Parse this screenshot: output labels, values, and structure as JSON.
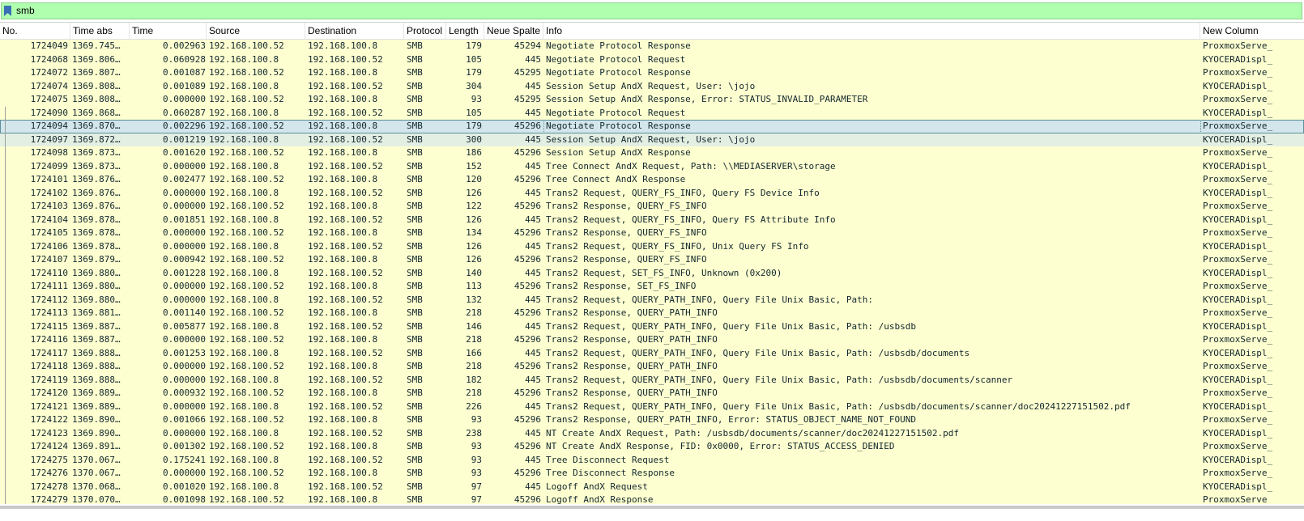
{
  "filter": {
    "value": "smb",
    "icon": "bookmark-icon",
    "bar_color": "#afffaf"
  },
  "columns": [
    "No.",
    "Time abs",
    "Time",
    "Source",
    "Destination",
    "Protocol",
    "Length",
    "Neue Spalte",
    "Info",
    "New Column"
  ],
  "colors": {
    "row_bg": "#feffd0",
    "selected_bg": "#d3e6eb",
    "hover_bg": "#e4efe3",
    "text": "#12272e"
  },
  "selected_index": 6,
  "hover_index": 7,
  "rows": [
    {
      "no": "1724049",
      "tabs": "1369.745…",
      "time": "0.002963",
      "src": "192.168.100.52",
      "dst": "192.168.100.8",
      "proto": "SMB",
      "len": "179",
      "ns": "45294",
      "info": "Negotiate Protocol Response",
      "nc": "ProxmoxServe_"
    },
    {
      "no": "1724068",
      "tabs": "1369.806…",
      "time": "0.060928",
      "src": "192.168.100.8",
      "dst": "192.168.100.52",
      "proto": "SMB",
      "len": "105",
      "ns": "445",
      "info": "Negotiate Protocol Request",
      "nc": "KYOCERADispl_"
    },
    {
      "no": "1724072",
      "tabs": "1369.807…",
      "time": "0.001087",
      "src": "192.168.100.52",
      "dst": "192.168.100.8",
      "proto": "SMB",
      "len": "179",
      "ns": "45295",
      "info": "Negotiate Protocol Response",
      "nc": "ProxmoxServe_"
    },
    {
      "no": "1724074",
      "tabs": "1369.808…",
      "time": "0.001089",
      "src": "192.168.100.8",
      "dst": "192.168.100.52",
      "proto": "SMB",
      "len": "304",
      "ns": "445",
      "info": "Session Setup AndX Request, User: \\jojo",
      "nc": "KYOCERADispl_"
    },
    {
      "no": "1724075",
      "tabs": "1369.808…",
      "time": "0.000000",
      "src": "192.168.100.52",
      "dst": "192.168.100.8",
      "proto": "SMB",
      "len": "93",
      "ns": "45295",
      "info": "Session Setup AndX Response, Error: STATUS_INVALID_PARAMETER",
      "nc": "ProxmoxServe_"
    },
    {
      "no": "1724090",
      "tabs": "1369.868…",
      "time": "0.060287",
      "src": "192.168.100.8",
      "dst": "192.168.100.52",
      "proto": "SMB",
      "len": "105",
      "ns": "445",
      "info": "Negotiate Protocol Request",
      "nc": "KYOCERADispl_"
    },
    {
      "no": "1724094",
      "tabs": "1369.870…",
      "time": "0.002296",
      "src": "192.168.100.52",
      "dst": "192.168.100.8",
      "proto": "SMB",
      "len": "179",
      "ns": "45296",
      "info": "Negotiate Protocol Response",
      "nc": "ProxmoxServe_"
    },
    {
      "no": "1724097",
      "tabs": "1369.872…",
      "time": "0.001219",
      "src": "192.168.100.8",
      "dst": "192.168.100.52",
      "proto": "SMB",
      "len": "300",
      "ns": "445",
      "info": "Session Setup AndX Request, User: \\jojo",
      "nc": "KYOCERADispl_"
    },
    {
      "no": "1724098",
      "tabs": "1369.873…",
      "time": "0.001620",
      "src": "192.168.100.52",
      "dst": "192.168.100.8",
      "proto": "SMB",
      "len": "186",
      "ns": "45296",
      "info": "Session Setup AndX Response",
      "nc": "ProxmoxServe_"
    },
    {
      "no": "1724099",
      "tabs": "1369.873…",
      "time": "0.000000",
      "src": "192.168.100.8",
      "dst": "192.168.100.52",
      "proto": "SMB",
      "len": "152",
      "ns": "445",
      "info": "Tree Connect AndX Request, Path: \\\\MEDIASERVER\\storage",
      "nc": "KYOCERADispl_"
    },
    {
      "no": "1724101",
      "tabs": "1369.876…",
      "time": "0.002477",
      "src": "192.168.100.52",
      "dst": "192.168.100.8",
      "proto": "SMB",
      "len": "120",
      "ns": "45296",
      "info": "Tree Connect AndX Response",
      "nc": "ProxmoxServe_"
    },
    {
      "no": "1724102",
      "tabs": "1369.876…",
      "time": "0.000000",
      "src": "192.168.100.8",
      "dst": "192.168.100.52",
      "proto": "SMB",
      "len": "126",
      "ns": "445",
      "info": "Trans2 Request, QUERY_FS_INFO, Query FS Device Info",
      "nc": "KYOCERADispl_"
    },
    {
      "no": "1724103",
      "tabs": "1369.876…",
      "time": "0.000000",
      "src": "192.168.100.52",
      "dst": "192.168.100.8",
      "proto": "SMB",
      "len": "122",
      "ns": "45296",
      "info": "Trans2 Response, QUERY_FS_INFO",
      "nc": "ProxmoxServe_"
    },
    {
      "no": "1724104",
      "tabs": "1369.878…",
      "time": "0.001851",
      "src": "192.168.100.8",
      "dst": "192.168.100.52",
      "proto": "SMB",
      "len": "126",
      "ns": "445",
      "info": "Trans2 Request, QUERY_FS_INFO, Query FS Attribute Info",
      "nc": "KYOCERADispl_"
    },
    {
      "no": "1724105",
      "tabs": "1369.878…",
      "time": "0.000000",
      "src": "192.168.100.52",
      "dst": "192.168.100.8",
      "proto": "SMB",
      "len": "134",
      "ns": "45296",
      "info": "Trans2 Response, QUERY_FS_INFO",
      "nc": "ProxmoxServe_"
    },
    {
      "no": "1724106",
      "tabs": "1369.878…",
      "time": "0.000000",
      "src": "192.168.100.8",
      "dst": "192.168.100.52",
      "proto": "SMB",
      "len": "126",
      "ns": "445",
      "info": "Trans2 Request, QUERY_FS_INFO, Unix Query FS Info",
      "nc": "KYOCERADispl_"
    },
    {
      "no": "1724107",
      "tabs": "1369.879…",
      "time": "0.000942",
      "src": "192.168.100.52",
      "dst": "192.168.100.8",
      "proto": "SMB",
      "len": "126",
      "ns": "45296",
      "info": "Trans2 Response, QUERY_FS_INFO",
      "nc": "ProxmoxServe_"
    },
    {
      "no": "1724110",
      "tabs": "1369.880…",
      "time": "0.001228",
      "src": "192.168.100.8",
      "dst": "192.168.100.52",
      "proto": "SMB",
      "len": "140",
      "ns": "445",
      "info": "Trans2 Request, SET_FS_INFO, Unknown (0x200)",
      "nc": "KYOCERADispl_"
    },
    {
      "no": "1724111",
      "tabs": "1369.880…",
      "time": "0.000000",
      "src": "192.168.100.52",
      "dst": "192.168.100.8",
      "proto": "SMB",
      "len": "113",
      "ns": "45296",
      "info": "Trans2 Response, SET_FS_INFO",
      "nc": "ProxmoxServe_"
    },
    {
      "no": "1724112",
      "tabs": "1369.880…",
      "time": "0.000000",
      "src": "192.168.100.8",
      "dst": "192.168.100.52",
      "proto": "SMB",
      "len": "132",
      "ns": "445",
      "info": "Trans2 Request, QUERY_PATH_INFO, Query File Unix Basic, Path:",
      "nc": "KYOCERADispl_"
    },
    {
      "no": "1724113",
      "tabs": "1369.881…",
      "time": "0.001140",
      "src": "192.168.100.52",
      "dst": "192.168.100.8",
      "proto": "SMB",
      "len": "218",
      "ns": "45296",
      "info": "Trans2 Response, QUERY_PATH_INFO",
      "nc": "ProxmoxServe_"
    },
    {
      "no": "1724115",
      "tabs": "1369.887…",
      "time": "0.005877",
      "src": "192.168.100.8",
      "dst": "192.168.100.52",
      "proto": "SMB",
      "len": "146",
      "ns": "445",
      "info": "Trans2 Request, QUERY_PATH_INFO, Query File Unix Basic, Path: /usbsdb",
      "nc": "KYOCERADispl_"
    },
    {
      "no": "1724116",
      "tabs": "1369.887…",
      "time": "0.000000",
      "src": "192.168.100.52",
      "dst": "192.168.100.8",
      "proto": "SMB",
      "len": "218",
      "ns": "45296",
      "info": "Trans2 Response, QUERY_PATH_INFO",
      "nc": "ProxmoxServe_"
    },
    {
      "no": "1724117",
      "tabs": "1369.888…",
      "time": "0.001253",
      "src": "192.168.100.8",
      "dst": "192.168.100.52",
      "proto": "SMB",
      "len": "166",
      "ns": "445",
      "info": "Trans2 Request, QUERY_PATH_INFO, Query File Unix Basic, Path: /usbsdb/documents",
      "nc": "KYOCERADispl_"
    },
    {
      "no": "1724118",
      "tabs": "1369.888…",
      "time": "0.000000",
      "src": "192.168.100.52",
      "dst": "192.168.100.8",
      "proto": "SMB",
      "len": "218",
      "ns": "45296",
      "info": "Trans2 Response, QUERY_PATH_INFO",
      "nc": "ProxmoxServe_"
    },
    {
      "no": "1724119",
      "tabs": "1369.888…",
      "time": "0.000000",
      "src": "192.168.100.8",
      "dst": "192.168.100.52",
      "proto": "SMB",
      "len": "182",
      "ns": "445",
      "info": "Trans2 Request, QUERY_PATH_INFO, Query File Unix Basic, Path: /usbsdb/documents/scanner",
      "nc": "KYOCERADispl_"
    },
    {
      "no": "1724120",
      "tabs": "1369.889…",
      "time": "0.000932",
      "src": "192.168.100.52",
      "dst": "192.168.100.8",
      "proto": "SMB",
      "len": "218",
      "ns": "45296",
      "info": "Trans2 Response, QUERY_PATH_INFO",
      "nc": "ProxmoxServe_"
    },
    {
      "no": "1724121",
      "tabs": "1369.889…",
      "time": "0.000000",
      "src": "192.168.100.8",
      "dst": "192.168.100.52",
      "proto": "SMB",
      "len": "226",
      "ns": "445",
      "info": "Trans2 Request, QUERY_PATH_INFO, Query File Unix Basic, Path: /usbsdb/documents/scanner/doc20241227151502.pdf",
      "nc": "KYOCERADispl_"
    },
    {
      "no": "1724122",
      "tabs": "1369.890…",
      "time": "0.001066",
      "src": "192.168.100.52",
      "dst": "192.168.100.8",
      "proto": "SMB",
      "len": "93",
      "ns": "45296",
      "info": "Trans2 Response, QUERY_PATH_INFO, Error: STATUS_OBJECT_NAME_NOT_FOUND",
      "nc": "ProxmoxServe_"
    },
    {
      "no": "1724123",
      "tabs": "1369.890…",
      "time": "0.000000",
      "src": "192.168.100.8",
      "dst": "192.168.100.52",
      "proto": "SMB",
      "len": "238",
      "ns": "445",
      "info": "NT Create AndX Request, Path: /usbsdb/documents/scanner/doc20241227151502.pdf",
      "nc": "KYOCERADispl_"
    },
    {
      "no": "1724124",
      "tabs": "1369.891…",
      "time": "0.001302",
      "src": "192.168.100.52",
      "dst": "192.168.100.8",
      "proto": "SMB",
      "len": "93",
      "ns": "45296",
      "info": "NT Create AndX Response, FID: 0x0000, Error: STATUS_ACCESS_DENIED",
      "nc": "ProxmoxServe_"
    },
    {
      "no": "1724275",
      "tabs": "1370.067…",
      "time": "0.175241",
      "src": "192.168.100.8",
      "dst": "192.168.100.52",
      "proto": "SMB",
      "len": "93",
      "ns": "445",
      "info": "Tree Disconnect Request",
      "nc": "KYOCERADispl_"
    },
    {
      "no": "1724276",
      "tabs": "1370.067…",
      "time": "0.000000",
      "src": "192.168.100.52",
      "dst": "192.168.100.8",
      "proto": "SMB",
      "len": "93",
      "ns": "45296",
      "info": "Tree Disconnect Response",
      "nc": "ProxmoxServe_"
    },
    {
      "no": "1724278",
      "tabs": "1370.068…",
      "time": "0.001020",
      "src": "192.168.100.8",
      "dst": "192.168.100.52",
      "proto": "SMB",
      "len": "97",
      "ns": "445",
      "info": "Logoff AndX Request",
      "nc": "KYOCERADispl_"
    },
    {
      "no": "1724279",
      "tabs": "1370.070…",
      "time": "0.001098",
      "src": "192.168.100.52",
      "dst": "192.168.100.8",
      "proto": "SMB",
      "len": "97",
      "ns": "45296",
      "info": "Logoff AndX Response",
      "nc": "ProxmoxServe_"
    }
  ]
}
